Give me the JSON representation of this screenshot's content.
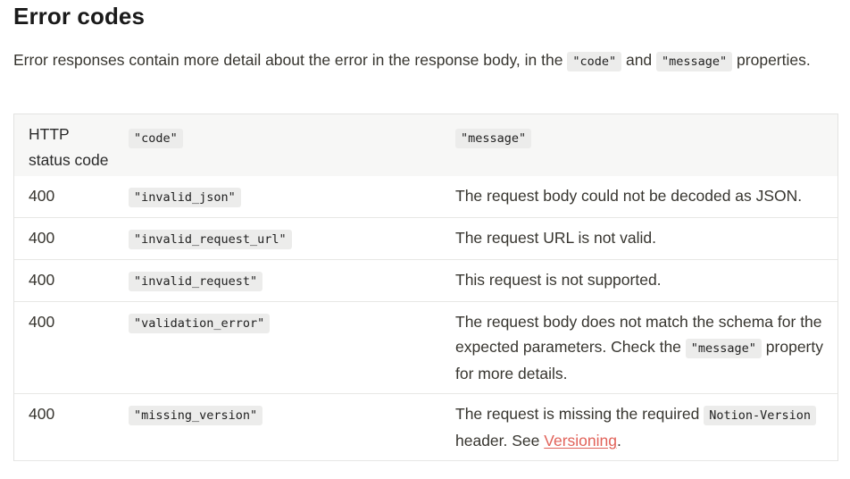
{
  "heading": "Error codes",
  "intro": {
    "text_before": "Error responses contain more detail about the error in the response body, in the ",
    "code1": "\"code\"",
    "text_mid": " and ",
    "code2": "\"message\"",
    "text_after": " properties."
  },
  "table": {
    "headers": {
      "status": "HTTP status code",
      "code": "\"code\"",
      "message": "\"message\""
    },
    "rows": [
      {
        "status": "400",
        "code": "\"invalid_json\"",
        "message": "The request body could not be decoded as JSON."
      },
      {
        "status": "400",
        "code": "\"invalid_request_url\"",
        "message": "The request URL is not valid."
      },
      {
        "status": "400",
        "code": "\"invalid_request\"",
        "message": "This request is not supported."
      },
      {
        "status": "400",
        "code": "\"validation_error\"",
        "message_before": "The request body does not match the schema for the expected parameters. Check the ",
        "message_code": "\"message\"",
        "message_after": " property for more details."
      },
      {
        "status": "400",
        "code": "\"missing_version\"",
        "message_before": "The request is missing the required ",
        "message_code": "Notion-Version",
        "message_mid": " header. See ",
        "message_link": "Versioning",
        "message_after": "."
      }
    ]
  }
}
